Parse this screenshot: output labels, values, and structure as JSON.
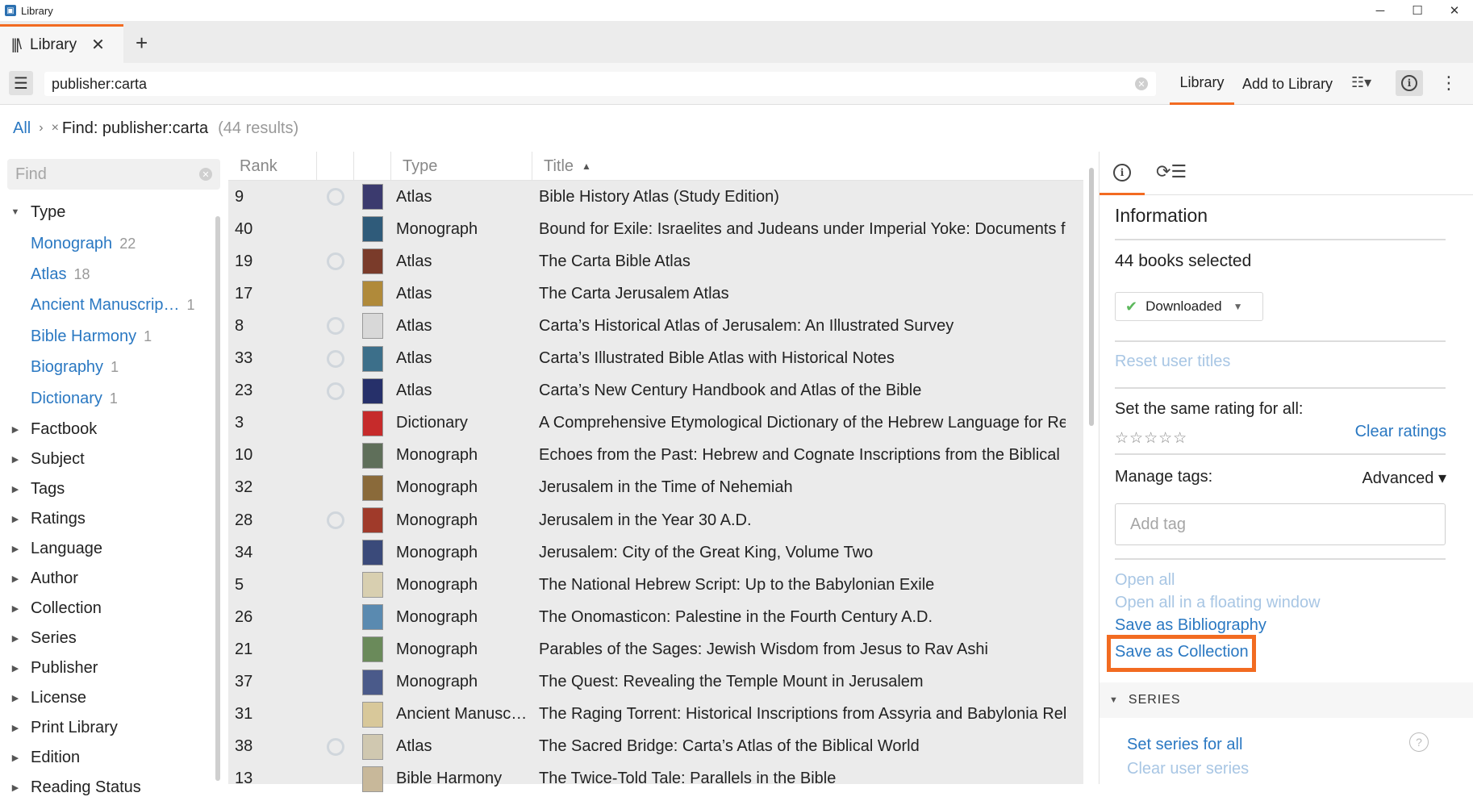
{
  "window": {
    "title": "Library",
    "app_icon": "calibre-icon",
    "controls": [
      "─",
      "☐",
      "✕"
    ]
  },
  "tab": {
    "label": "Library",
    "close": "✕",
    "add": "+"
  },
  "toolbar": {
    "search_value": "publisher:carta",
    "library_tab": "Library",
    "add_tab": "Add to Library",
    "grid_icon": "☷▾",
    "info_icon": "i",
    "more_icon": "⋮",
    "menu_icon": "☰"
  },
  "breadcrumb": {
    "all": "All",
    "sep": "›",
    "clear": "×",
    "find": "Find: publisher:carta",
    "count": "(44 results)"
  },
  "sidebar": {
    "find_placeholder": "Find",
    "type_label": "Type",
    "type_values": [
      {
        "label": "Monograph",
        "count": "22"
      },
      {
        "label": "Atlas",
        "count": "18"
      },
      {
        "label": "Ancient Manuscrip…",
        "count": "1"
      },
      {
        "label": "Bible Harmony",
        "count": "1"
      },
      {
        "label": "Biography",
        "count": "1"
      },
      {
        "label": "Dictionary",
        "count": "1"
      }
    ],
    "facets": [
      "Factbook",
      "Subject",
      "Tags",
      "Ratings",
      "Language",
      "Author",
      "Collection",
      "Series",
      "Publisher",
      "License",
      "Print Library",
      "Edition",
      "Reading Status"
    ]
  },
  "table": {
    "headers": {
      "rank": "Rank",
      "type": "Type",
      "title": "Title"
    },
    "rows": [
      {
        "rank": "9",
        "progress": true,
        "type": "Atlas",
        "title": "Bible History Atlas (Study Edition)",
        "cover": "#3b3a6e"
      },
      {
        "rank": "40",
        "progress": false,
        "type": "Monograph",
        "title": "Bound for Exile: Israelites and Judeans under Imperial Yoke: Documents from Assyria and Babylonia",
        "cover": "#2f5b7a"
      },
      {
        "rank": "19",
        "progress": true,
        "type": "Atlas",
        "title": "The Carta Bible Atlas",
        "cover": "#7a3b2a"
      },
      {
        "rank": "17",
        "progress": false,
        "type": "Atlas",
        "title": "The Carta Jerusalem Atlas",
        "cover": "#b08a3a"
      },
      {
        "rank": "8",
        "progress": true,
        "type": "Atlas",
        "title": "Carta’s Historical Atlas of Jerusalem: An Illustrated Survey",
        "cover": "#d8d8d8"
      },
      {
        "rank": "33",
        "progress": true,
        "type": "Atlas",
        "title": "Carta’s Illustrated Bible Atlas with Historical Notes",
        "cover": "#3c6f8a"
      },
      {
        "rank": "23",
        "progress": true,
        "type": "Atlas",
        "title": "Carta’s New Century Handbook and Atlas of the Bible",
        "cover": "#26306a"
      },
      {
        "rank": "3",
        "progress": false,
        "type": "Dictionary",
        "title": "A Comprehensive Etymological Dictionary of the Hebrew Language for Readers of English",
        "cover": "#c62b2b"
      },
      {
        "rank": "10",
        "progress": false,
        "type": "Monograph",
        "title": "Echoes from the Past: Hebrew and Cognate Inscriptions from the Biblical Period",
        "cover": "#5f6f5a"
      },
      {
        "rank": "32",
        "progress": false,
        "type": "Monograph",
        "title": "Jerusalem in the Time of Nehemiah",
        "cover": "#8a6a3a"
      },
      {
        "rank": "28",
        "progress": true,
        "type": "Monograph",
        "title": "Jerusalem in the Year 30 A.D.",
        "cover": "#a03a2a"
      },
      {
        "rank": "34",
        "progress": false,
        "type": "Monograph",
        "title": "Jerusalem: City of the Great King, Volume Two",
        "cover": "#3a4a7a"
      },
      {
        "rank": "5",
        "progress": false,
        "type": "Monograph",
        "title": "The National Hebrew Script: Up to the Babylonian Exile",
        "cover": "#d8cfb0"
      },
      {
        "rank": "26",
        "progress": false,
        "type": "Monograph",
        "title": "The Onomasticon: Palestine in the Fourth Century A.D.",
        "cover": "#5a8ab0"
      },
      {
        "rank": "21",
        "progress": false,
        "type": "Monograph",
        "title": "Parables of the Sages: Jewish Wisdom from Jesus to Rav Ashi",
        "cover": "#6a8a5a"
      },
      {
        "rank": "37",
        "progress": false,
        "type": "Monograph",
        "title": "The Quest: Revealing the Temple Mount in Jerusalem",
        "cover": "#4a5a8a"
      },
      {
        "rank": "31",
        "progress": false,
        "type": "Ancient Manusc…",
        "title": "The Raging Torrent: Historical Inscriptions from Assyria and Babylonia Relating to Ancient Israel",
        "cover": "#d8c89a"
      },
      {
        "rank": "38",
        "progress": true,
        "type": "Atlas",
        "title": "The Sacred Bridge: Carta’s Atlas of the Biblical World",
        "cover": "#d0c8b0"
      },
      {
        "rank": "13",
        "progress": false,
        "type": "Bible Harmony",
        "title": "The Twice-Told Tale: Parallels in the Bible",
        "cover": "#c8b89a"
      }
    ]
  },
  "panel": {
    "info_icon": "i",
    "sync_icon": "⟳☰",
    "heading": "Information",
    "selected": "44 books selected",
    "downloaded": "Downloaded",
    "reset_titles": "Reset user titles",
    "rating_label": "Set the same rating for all:",
    "stars": "☆☆☆☆☆",
    "clear_ratings": "Clear ratings",
    "manage_tags": "Manage tags:",
    "advanced": "Advanced ▾",
    "add_tag_placeholder": "Add tag",
    "open_all": "Open all",
    "open_floating": "Open all in a floating window",
    "save_bibliography": "Save as Bibliography",
    "save_collection": "Save as Collection",
    "series_heading": "SERIES",
    "set_series": "Set series for all",
    "clear_series": "Clear user series"
  },
  "colors": {
    "accent": "#f26b21",
    "link": "#2a78c2",
    "link_disabled": "#a8c6e4"
  }
}
